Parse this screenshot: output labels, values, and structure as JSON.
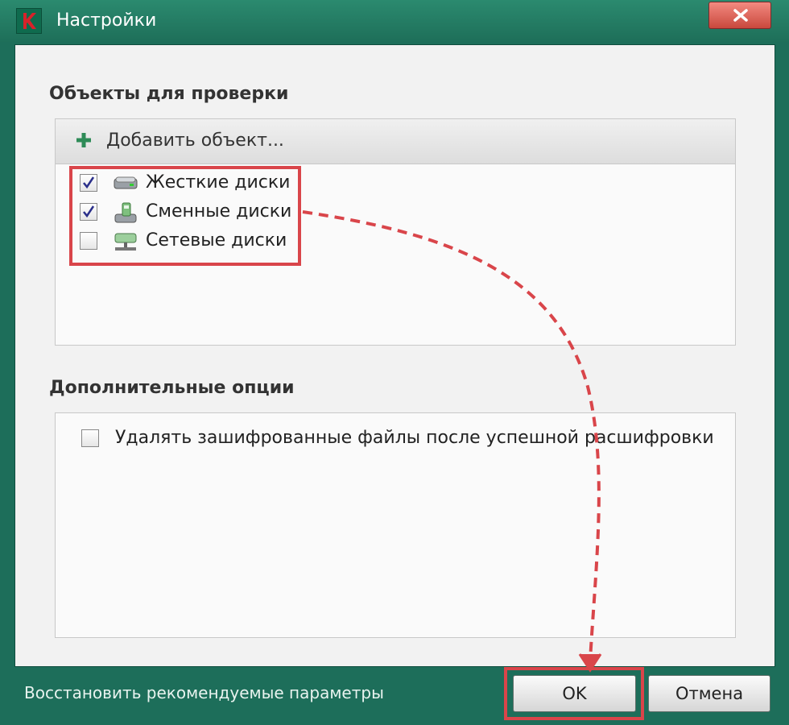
{
  "window": {
    "title": "Настройки",
    "close_icon": "close-x-icon",
    "logo_letter": "K"
  },
  "scan_objects": {
    "heading": "Объекты для проверки",
    "add_label": "Добавить объект...",
    "items": [
      {
        "label": "Жесткие диски",
        "checked": true,
        "icon": "hard-drive-icon"
      },
      {
        "label": "Сменные диски",
        "checked": true,
        "icon": "removable-drive-icon"
      },
      {
        "label": "Сетевые диски",
        "checked": false,
        "icon": "network-drive-icon"
      }
    ]
  },
  "extra_options": {
    "heading": "Дополнительные опции",
    "items": [
      {
        "label": "Удалять зашифрованные файлы после успешной расшифровки",
        "checked": false
      }
    ]
  },
  "footer": {
    "restore_label": "Восстановить рекомендуемые параметры",
    "ok_label": "OK",
    "cancel_label": "Отмена"
  },
  "colors": {
    "frame": "#1d6e5a",
    "annotation_red": "#d9454a",
    "accent_green": "#2e8b57"
  }
}
